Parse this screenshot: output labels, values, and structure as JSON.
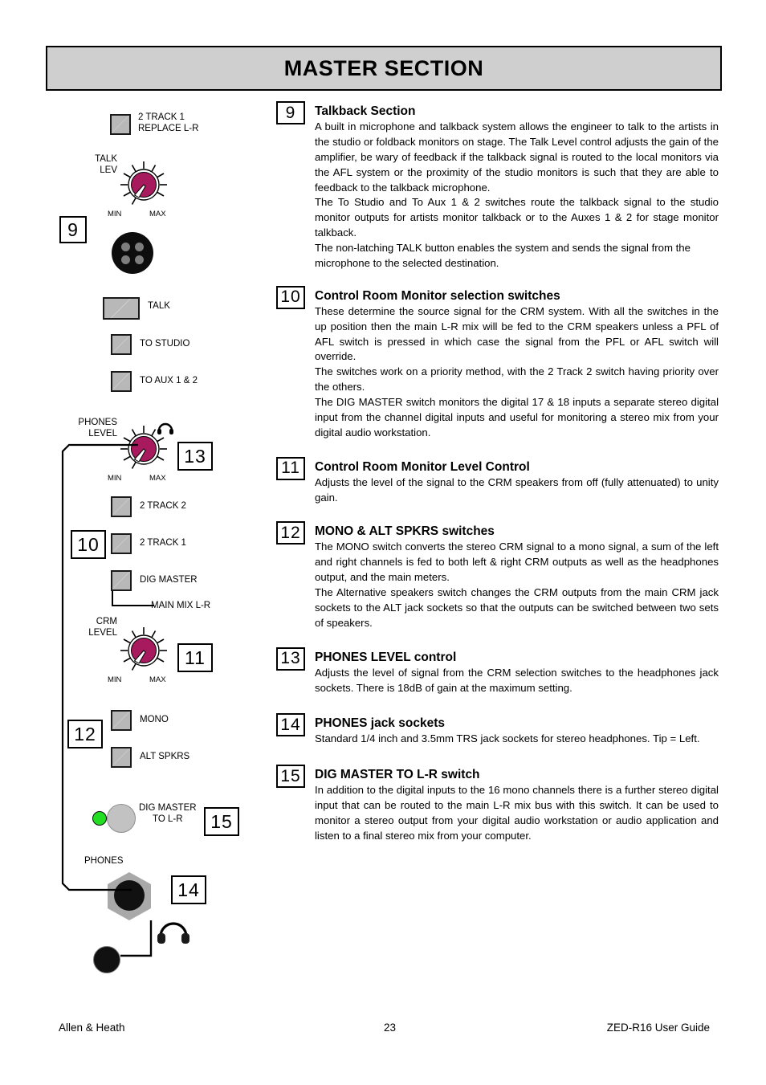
{
  "header": {
    "title": "MASTER SECTION"
  },
  "diagram": {
    "controls": {
      "two_track_1_replace": "2 TRACK 1\nREPLACE L-R",
      "talk_lev": "TALK\nLEV",
      "talk": "TALK",
      "to_studio": "TO STUDIO",
      "to_aux": "TO AUX 1 & 2",
      "phones_level": "PHONES\nLEVEL",
      "two_track_2": "2 TRACK 2",
      "two_track_1": "2 TRACK 1",
      "dig_master": "DIG MASTER",
      "main_mix_lr": "MAIN MIX L-R",
      "crm_level": "CRM\nLEVEL",
      "mono": "MONO",
      "alt_spkrs": "ALT SPKRS",
      "dig_master_to_lr": "DIG MASTER\nTO L-R",
      "phones": "PHONES"
    },
    "knob_scale": {
      "min": "MIN",
      "max": "MAX"
    },
    "callouts": {
      "c9": "9",
      "c10": "10",
      "c11": "11",
      "c12": "12",
      "c13": "13",
      "c14": "14",
      "c15": "15"
    },
    "colors": {
      "knob_fill": "#a81a5e",
      "switch_cap": "#b8b8b8",
      "led_green": "#22dd22",
      "banner_bg": "#cfcfcf"
    }
  },
  "sections": [
    {
      "number": "9",
      "title": "Talkback Section",
      "paragraphs": [
        "A built in microphone and talkback system allows the engineer to talk to the artists in the studio or foldback monitors on stage. The Talk Level control adjusts the gain of the amplifier, be wary of feedback if the talkback signal is routed to the local monitors via the AFL system or the proximity of the studio monitors is such that they are able to feedback to the talkback microphone.",
        "The To Studio and To Aux 1 & 2 switches route the talkback signal to the studio monitor outputs for artists monitor talkback or to the Auxes 1 & 2 for stage monitor talkback.",
        "The non-latching TALK button enables the system and sends the signal from the microphone to the selected destination."
      ]
    },
    {
      "number": "10",
      "title": "Control Room Monitor selection switches",
      "paragraphs": [
        "These determine the source signal for the CRM system. With all the switches in the up position then the main L-R mix will be fed to the CRM speakers unless a PFL of AFL switch is pressed in which case the signal from the PFL or AFL switch will override.",
        "The switches work on a priority method, with the 2 Track 2 switch having priority over the others.",
        "The DIG MASTER switch monitors the digital 17 & 18 inputs a separate stereo digital input from the channel digital inputs and useful for monitoring a stereo mix from your digital audio workstation."
      ]
    },
    {
      "number": "11",
      "title": "Control Room Monitor Level Control",
      "paragraphs": [
        "Adjusts the level of the signal to the CRM speakers from off (fully attenuated) to unity gain."
      ]
    },
    {
      "number": "12",
      "title_strong": "MONO & ALT SPKRS",
      "title_rest": " switches",
      "title": "MONO & ALT SPKRS switches",
      "paragraphs": [
        "The MONO switch converts the stereo CRM signal to a mono signal, a sum of the left and right channels is fed to both left & right CRM outputs as well as the headphones output, and the main meters.",
        "The Alternative speakers switch changes the CRM outputs from the main CRM jack sockets to the ALT jack sockets so that the outputs can be switched between two sets of speakers."
      ]
    },
    {
      "number": "13",
      "title": "PHONES LEVEL control",
      "paragraphs": [
        "Adjusts the level of signal from the CRM selection switches to the headphones jack sockets. There is 18dB of gain at the maximum setting."
      ]
    },
    {
      "number": "14",
      "title": "PHONES jack sockets",
      "paragraphs": [
        "Standard 1/4 inch and 3.5mm TRS jack sockets for stereo headphones. Tip = Left."
      ]
    },
    {
      "number": "15",
      "title": "DIG MASTER TO L-R switch",
      "paragraphs": [
        "In addition to the digital inputs to the 16 mono channels there is a further stereo digital input that can be routed to the main L-R mix bus with this switch. It can be used to monitor a stereo output from your digital audio workstation or audio application and listen to a final stereo mix from your computer."
      ]
    }
  ],
  "footer": {
    "left": "Allen & Heath",
    "page": "23",
    "right": "ZED-R16 User Guide"
  }
}
